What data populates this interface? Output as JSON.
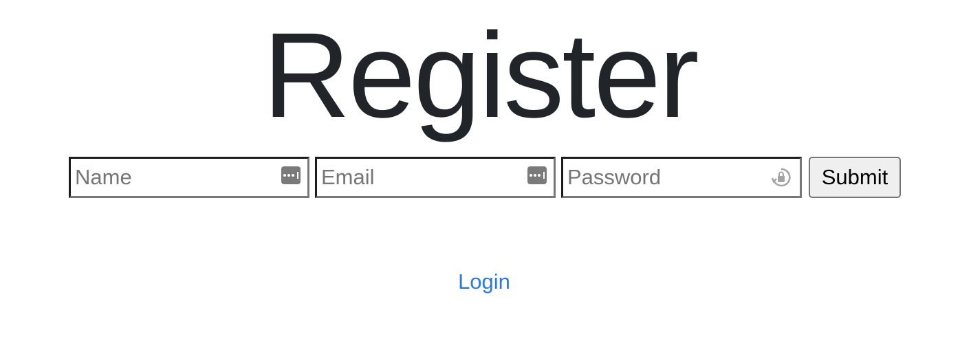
{
  "page": {
    "title": "Register"
  },
  "form": {
    "name": {
      "placeholder": "Name",
      "value": ""
    },
    "email": {
      "placeholder": "Email",
      "value": ""
    },
    "password": {
      "placeholder": "Password",
      "value": ""
    },
    "submit_label": "Submit"
  },
  "links": {
    "login_label": "Login"
  },
  "icons": {
    "name_field": "autofill-key-icon",
    "email_field": "autofill-key-icon",
    "password_field": "password-lock-icon"
  },
  "colors": {
    "title": "#212529",
    "link": "#2a7ae2",
    "button_bg": "#efefef"
  }
}
